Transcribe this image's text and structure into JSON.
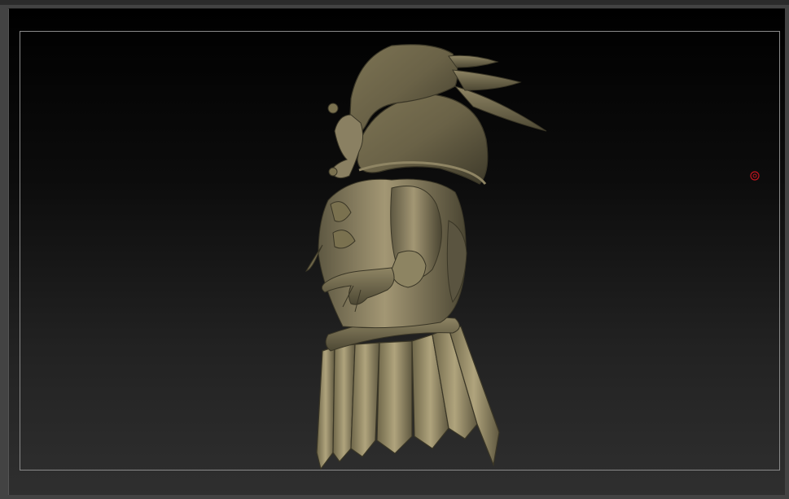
{
  "viewport": {
    "background_top": "#000000",
    "background_bottom": "#2f2f2f",
    "frame_color": "#8a8a8a"
  },
  "model": {
    "material_color": "#8c8260",
    "highlight_color": "#b3a67c",
    "shadow_color": "#3e3a2a"
  },
  "cursor": {
    "color": "#c0141e",
    "icon": "draw-cursor-icon"
  }
}
